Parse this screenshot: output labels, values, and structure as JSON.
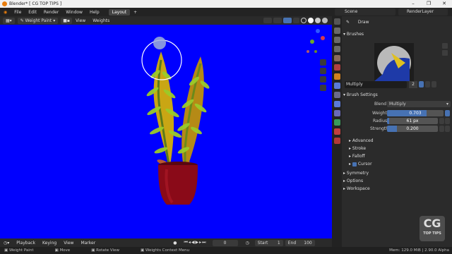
{
  "titlebar": {
    "title": "Blender* [ CG TOP TIPS ]"
  },
  "menu": {
    "items": [
      "File",
      "Edit",
      "Render",
      "Window",
      "Help"
    ],
    "workspace_tab": "Layout",
    "add_tab": "+",
    "scene": "Scene",
    "view_layer": "RenderLayer"
  },
  "viewport_header": {
    "mode": "Weight Paint",
    "menus": [
      "View",
      "Weights"
    ]
  },
  "props": {
    "tool": "Draw",
    "brushes_label": "Brushes",
    "brush_name": "Multiply",
    "brush_users": "2",
    "brush_settings_label": "Brush Settings",
    "blend_label": "Blend",
    "blend_value": "Multiply",
    "weight_label": "Weight",
    "weight_value": "0.703",
    "weight_fraction": 0.703,
    "radius_label": "Radius",
    "radius_value": "61 px",
    "strength_label": "Strength",
    "strength_value": "0.200",
    "strength_fraction": 0.2,
    "subpanels": [
      "Advanced",
      "Stroke",
      "Falloff",
      "Cursor"
    ],
    "panels": [
      "Symmetry",
      "Options",
      "Workspace"
    ]
  },
  "timeline": {
    "menus": [
      "Playback",
      "Keying",
      "View",
      "Marker"
    ],
    "current_frame": "0",
    "start_label": "Start",
    "start": "1",
    "end_label": "End",
    "end": "100"
  },
  "status": {
    "items": [
      "Weight Paint",
      "Move",
      "Rotate View",
      "Weights Context Menu"
    ],
    "memory": "Mem: 129.0 MiB | 2.90.0 Alpha"
  },
  "watermark": {
    "line1": "CG",
    "line2": "TOP TIPS"
  },
  "colors": {
    "viewport_bg": "#0000ff",
    "accent": "#4772b3",
    "pot": "#8a0a18"
  }
}
